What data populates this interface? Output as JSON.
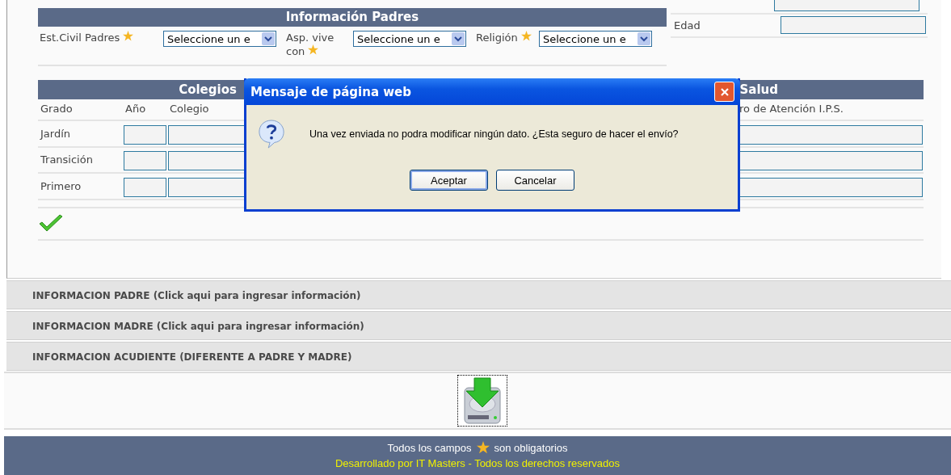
{
  "padres": {
    "title": "Información Padres",
    "fields": [
      {
        "label": "Est.Civil Padres",
        "required": true,
        "value": "Seleccione un e"
      },
      {
        "label": "Asp. vive con",
        "required": true,
        "value": "Seleccione un e"
      },
      {
        "label": "Religión",
        "required": true,
        "value": "Seleccione un e"
      }
    ]
  },
  "personal": {
    "rows": [
      {
        "label": "Edad"
      }
    ]
  },
  "colegios": {
    "title": "Colegios",
    "columns": [
      "Grado",
      "Año",
      "Colegio"
    ],
    "rows": [
      "Jardín",
      "Transición",
      "Primero"
    ]
  },
  "salud": {
    "title": "Salud",
    "columns": [
      "ro de Atención I.P.S."
    ]
  },
  "sections": [
    "INFORMACION PADRE (Click aqui para ingresar información)",
    "INFORMACION MADRE (Click aqui para ingresar información)",
    "INFORMACION ACUDIENTE (DIFERENTE A PADRE Y MADRE)"
  ],
  "footer": {
    "note_before": "Todos los campos",
    "note_after": "son obligatorios",
    "credits": "Desarrollado por IT Masters - Todos los derechos reservados"
  },
  "dialog": {
    "title": "Mensaje de página web",
    "message": "Una vez enviada no podra modificar ningún dato. ¿Esta seguro de hacer el envío?",
    "buttons": [
      {
        "label": "Aceptar",
        "default": true
      },
      {
        "label": "Cancelar",
        "default": false
      }
    ]
  }
}
